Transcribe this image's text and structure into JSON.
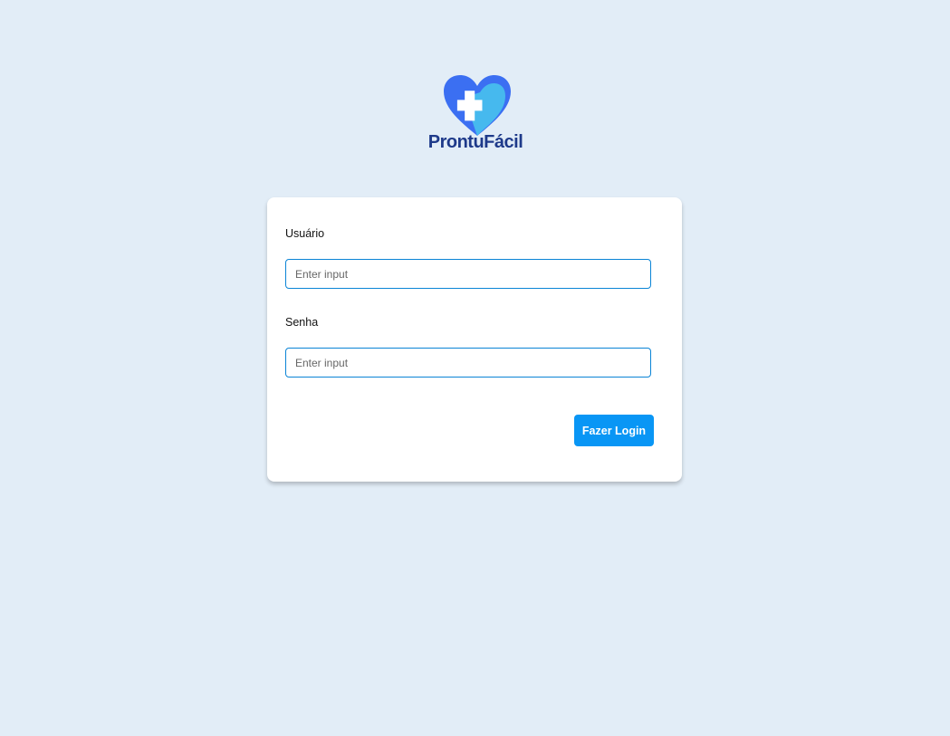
{
  "brand": {
    "name": "ProntuFácil",
    "logo_icon": "heart-cross-icon",
    "colors": {
      "heart_dark": "#3b6ff2",
      "heart_light": "#46b9ee",
      "text": "#1e3a8a"
    }
  },
  "login_form": {
    "username_label": "Usuário",
    "username_placeholder": "Enter input",
    "password_label": "Senha",
    "password_placeholder": "Enter input",
    "submit_label": "Fazer Login"
  },
  "colors": {
    "background": "#e2edf7",
    "card": "#ffffff",
    "accent": "#0996f5",
    "input_border": "#0a84d6"
  }
}
